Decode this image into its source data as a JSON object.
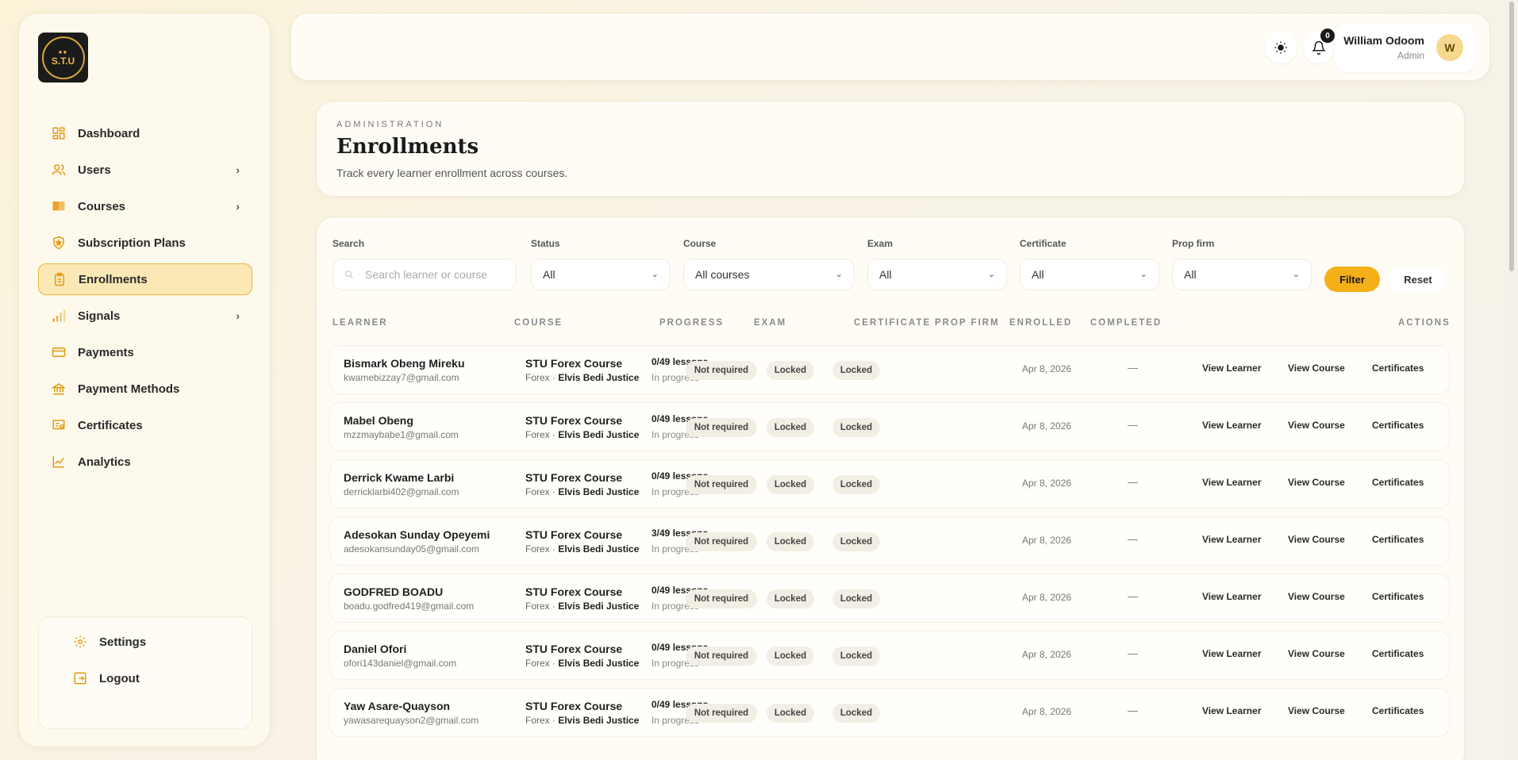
{
  "brand": {
    "logo_text": "S.T.U"
  },
  "sidebar": {
    "items": [
      {
        "label": "Dashboard",
        "icon": "grid-icon",
        "has_children": false
      },
      {
        "label": "Users",
        "icon": "users-icon",
        "has_children": true
      },
      {
        "label": "Courses",
        "icon": "book-icon",
        "has_children": true
      },
      {
        "label": "Subscription Plans",
        "icon": "shield-star-icon",
        "has_children": false
      },
      {
        "label": "Enrollments",
        "icon": "clipboard-icon",
        "has_children": false,
        "active": true
      },
      {
        "label": "Signals",
        "icon": "signal-bars-icon",
        "has_children": true
      },
      {
        "label": "Payments",
        "icon": "card-icon",
        "has_children": false
      },
      {
        "label": "Payment Methods",
        "icon": "bank-icon",
        "has_children": false
      },
      {
        "label": "Certificates",
        "icon": "certificate-icon",
        "has_children": false
      },
      {
        "label": "Analytics",
        "icon": "line-chart-icon",
        "has_children": false
      }
    ],
    "footer": [
      {
        "label": "Settings",
        "icon": "gear-icon"
      },
      {
        "label": "Logout",
        "icon": "logout-icon"
      }
    ]
  },
  "topbar": {
    "notification_count": "0",
    "user": {
      "name": "William Odoom",
      "role": "Admin",
      "initial": "W"
    }
  },
  "header": {
    "eyebrow": "ADMINISTRATION",
    "title": "Enrollments",
    "subtitle": "Track every learner enrollment across courses."
  },
  "filters": {
    "search": {
      "label": "Search",
      "placeholder": "Search learner or course"
    },
    "status": {
      "label": "Status",
      "value": "All"
    },
    "course": {
      "label": "Course",
      "value": "All courses"
    },
    "exam": {
      "label": "Exam",
      "value": "All"
    },
    "certificate": {
      "label": "Certificate",
      "value": "All"
    },
    "prop_firm": {
      "label": "Prop firm",
      "value": "All"
    },
    "filter_label": "Filter",
    "reset_label": "Reset"
  },
  "table": {
    "columns": {
      "learner": "LEARNER",
      "course": "COURSE",
      "progress": "PROGRESS",
      "exam": "EXAM",
      "certificate": "CERTIFICATE",
      "prop_firm": "PROP FIRM",
      "enrolled": "ENROLLED",
      "completed": "COMPLETED",
      "actions": "ACTIONS"
    },
    "action_labels": {
      "view_learner": "View Learner",
      "view_course": "View Course",
      "certificates": "Certificates"
    },
    "rows": [
      {
        "name": "Bismark Obeng Mireku",
        "email": "kwamebizzay7@gmail.com",
        "course": "STU Forex Course",
        "category": "Forex · ",
        "instructor": "Elvis Bedi Justice",
        "progress": "0/49 lessons",
        "state": "In progress",
        "exam": "Not required",
        "certificate": "Locked",
        "prop_firm": "Locked",
        "enrolled": "Apr 8, 2026",
        "completed": "—"
      },
      {
        "name": "Mabel Obeng",
        "email": "mzzmaybabe1@gmail.com",
        "course": "STU Forex Course",
        "category": "Forex · ",
        "instructor": "Elvis Bedi Justice",
        "progress": "0/49 lessons",
        "state": "In progress",
        "exam": "Not required",
        "certificate": "Locked",
        "prop_firm": "Locked",
        "enrolled": "Apr 8, 2026",
        "completed": "—"
      },
      {
        "name": "Derrick Kwame Larbi",
        "email": "derricklarbi402@gmail.com",
        "course": "STU Forex Course",
        "category": "Forex · ",
        "instructor": "Elvis Bedi Justice",
        "progress": "0/49 lessons",
        "state": "In progress",
        "exam": "Not required",
        "certificate": "Locked",
        "prop_firm": "Locked",
        "enrolled": "Apr 8, 2026",
        "completed": "—"
      },
      {
        "name": "Adesokan Sunday Opeyemi",
        "email": "adesokansunday05@gmail.com",
        "course": "STU Forex Course",
        "category": "Forex · ",
        "instructor": "Elvis Bedi Justice",
        "progress": "3/49 lessons",
        "state": "In progress",
        "exam": "Not required",
        "certificate": "Locked",
        "prop_firm": "Locked",
        "enrolled": "Apr 8, 2026",
        "completed": "—"
      },
      {
        "name": "GODFRED BOADU",
        "email": "boadu.godfred419@gmail.com",
        "course": "STU Forex Course",
        "category": "Forex · ",
        "instructor": "Elvis Bedi Justice",
        "progress": "0/49 lessons",
        "state": "In progress",
        "exam": "Not required",
        "certificate": "Locked",
        "prop_firm": "Locked",
        "enrolled": "Apr 8, 2026",
        "completed": "—"
      },
      {
        "name": "Daniel Ofori",
        "email": "ofori143daniel@gmail.com",
        "course": "STU Forex Course",
        "category": "Forex · ",
        "instructor": "Elvis Bedi Justice",
        "progress": "0/49 lessons",
        "state": "In progress",
        "exam": "Not required",
        "certificate": "Locked",
        "prop_firm": "Locked",
        "enrolled": "Apr 8, 2026",
        "completed": "—"
      },
      {
        "name": "Yaw Asare-Quayson",
        "email": "yawasarequayson2@gmail.com",
        "course": "STU Forex Course",
        "category": "Forex · ",
        "instructor": "Elvis Bedi Justice",
        "progress": "0/49 lessons",
        "state": "In progress",
        "exam": "Not required",
        "certificate": "Locked",
        "prop_firm": "Locked",
        "enrolled": "Apr 8, 2026",
        "completed": "—"
      }
    ]
  },
  "colors": {
    "accent": "#f5b018",
    "active_bg": "#fbe8b5",
    "active_border": "#ebb53a"
  }
}
